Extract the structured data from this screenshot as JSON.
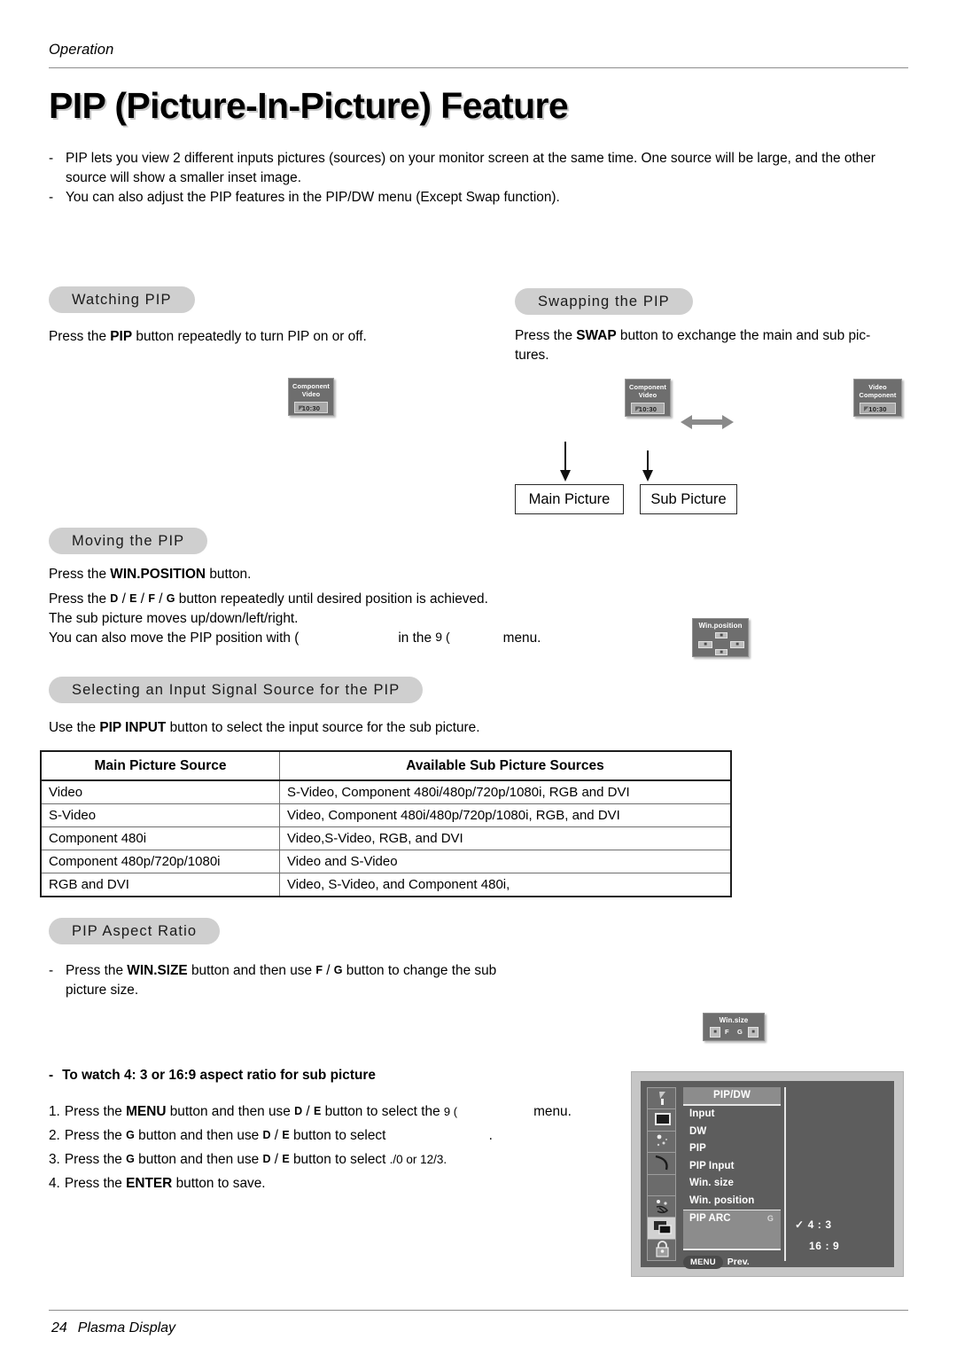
{
  "header": {
    "running_head": "Operation",
    "title": "PIP (Picture-In-Picture) Feature"
  },
  "intro": {
    "bullet_mark": "-",
    "items": [
      "PIP lets you view 2 different inputs pictures (sources) on your monitor screen at the same time. One source will be large, and the other source will show a smaller inset image.",
      "You can also adjust the PIP features in the PIP/DW menu (Except Swap function)."
    ]
  },
  "sections": {
    "watching": {
      "pill": "Watching PIP",
      "text_pre": "Press the ",
      "text_bold": "PIP",
      "text_post": " button repeatedly to turn PIP on or off."
    },
    "swapping": {
      "pill": "Swapping the PIP",
      "text_pre": "Press the ",
      "text_bold": "SWAP",
      "text_post": " button to exchange the main and sub pic-",
      "text_line2": "tures.",
      "main_caption": "Main Picture",
      "sub_caption": "Sub Picture"
    },
    "moving": {
      "pill": "Moving the PIP",
      "line1_pre": "Press the ",
      "line1_bold": "WIN.POSITION",
      "line1_post": " button.",
      "line2_pre": "Press the ",
      "line2_keys": [
        "D",
        "E",
        "F",
        "G"
      ],
      "line2_post": " button repeatedly until desired position is achieved.",
      "line3": "The sub picture moves up/down/left/right.",
      "line4_pre": "You can also move the PIP position with ",
      "line4_glyph1": "(",
      "line4_mid": "in the ",
      "line4_glyph2": "9 (",
      "line4_post": "menu."
    },
    "input_source": {
      "pill": "Selecting an Input Signal Source for the PIP",
      "text_pre": "Use the ",
      "text_bold": "PIP INPUT",
      "text_post": " button to select the input source for the sub picture."
    },
    "aspect": {
      "pill": "PIP Aspect Ratio",
      "bullet_mark": "-",
      "line1_pre": "Press the ",
      "line1_bold": "WIN.SIZE",
      "line1_mid": " button and then use ",
      "line1_keys": [
        "F",
        "G"
      ],
      "line1_post": " button to change the sub",
      "line2": "picture size.",
      "watch_heading_mark": "-",
      "watch_heading": "To watch 4: 3 or 16:9 aspect ratio for sub picture",
      "steps": [
        {
          "num": "1.",
          "pre": "Press the ",
          "bold": "MENU",
          "mid": " button and then use ",
          "keys": [
            "D",
            "E"
          ],
          "post": " button to select the ",
          "glyph": "9 (",
          "tail": "menu."
        },
        {
          "num": "2.",
          "pre": "Press the ",
          "bold": "G",
          "mid": " button and then use ",
          "keys": [
            "D",
            "E"
          ],
          "post": " button to select ",
          "glyph": "",
          "tail": "."
        },
        {
          "num": "3.",
          "pre": "Press the ",
          "bold": "G",
          "mid": " button and then use ",
          "keys": [
            "D",
            "E"
          ],
          "post": " button to select ",
          "glyph": "./0",
          "tail": " or 12/3."
        },
        {
          "num": "4.",
          "pre": "Press the ",
          "bold": "ENTER",
          "mid": "",
          "keys": [],
          "post": " button to save.",
          "glyph": "",
          "tail": ""
        }
      ]
    }
  },
  "tv_graphics": {
    "watching": {
      "line1": "Component",
      "line2": "Video",
      "clock": "10:30"
    },
    "swap_before": {
      "line1": "Component",
      "line2": "Video",
      "clock": "10:30"
    },
    "swap_after": {
      "line1": "Video",
      "line2": "Component",
      "clock": "10:30"
    }
  },
  "remotes": {
    "win_position": {
      "caption": "Win.position"
    },
    "win_size": {
      "caption": "Win.size",
      "left_glyph": "F",
      "right_glyph": "G"
    }
  },
  "table": {
    "headers": [
      "Main Picture Source",
      "Available Sub Picture Sources"
    ],
    "rows": [
      [
        "Video",
        "S-Video, Component 480i/480p/720p/1080i, RGB and DVI"
      ],
      [
        "S-Video",
        "Video, Component 480i/480p/720p/1080i, RGB, and DVI"
      ],
      [
        "Component 480i",
        "Video,S-Video, RGB, and DVI"
      ],
      [
        "Component 480p/720p/1080i",
        "Video and S-Video"
      ],
      [
        "RGB and DVI",
        "Video, S-Video, and Component 480i,"
      ]
    ]
  },
  "osd": {
    "title": "PIP/DW",
    "items": [
      "Input",
      "DW",
      "PIP",
      "PIP Input",
      "Win. size",
      "Win. position"
    ],
    "highlighted_item": "PIP ARC",
    "highlighted_arrow": "G",
    "options": [
      {
        "label": "4 : 3",
        "check": "✓"
      },
      {
        "label": "16 : 9",
        "check": ""
      }
    ],
    "menu_button": "MENU",
    "prev_label": "Prev.",
    "sidebar_icons": [
      "brightness-icon",
      "picture-icon",
      "sound-icon",
      "timer-icon",
      "blank-icon",
      "special-icon",
      "pip-dw-icon",
      "lock-icon"
    ]
  },
  "footer": {
    "page_number": "24",
    "product": "Plasma Display"
  },
  "colors": {
    "pill_bg": "#cfcfcf",
    "osd_panel_bg": "#c6c6c6",
    "osd_screen_bg": "#5d5d5d",
    "osd_highlight": "#8c8c8c",
    "tv_body": "#6e6e6e",
    "rule": "#8d8d8d"
  }
}
